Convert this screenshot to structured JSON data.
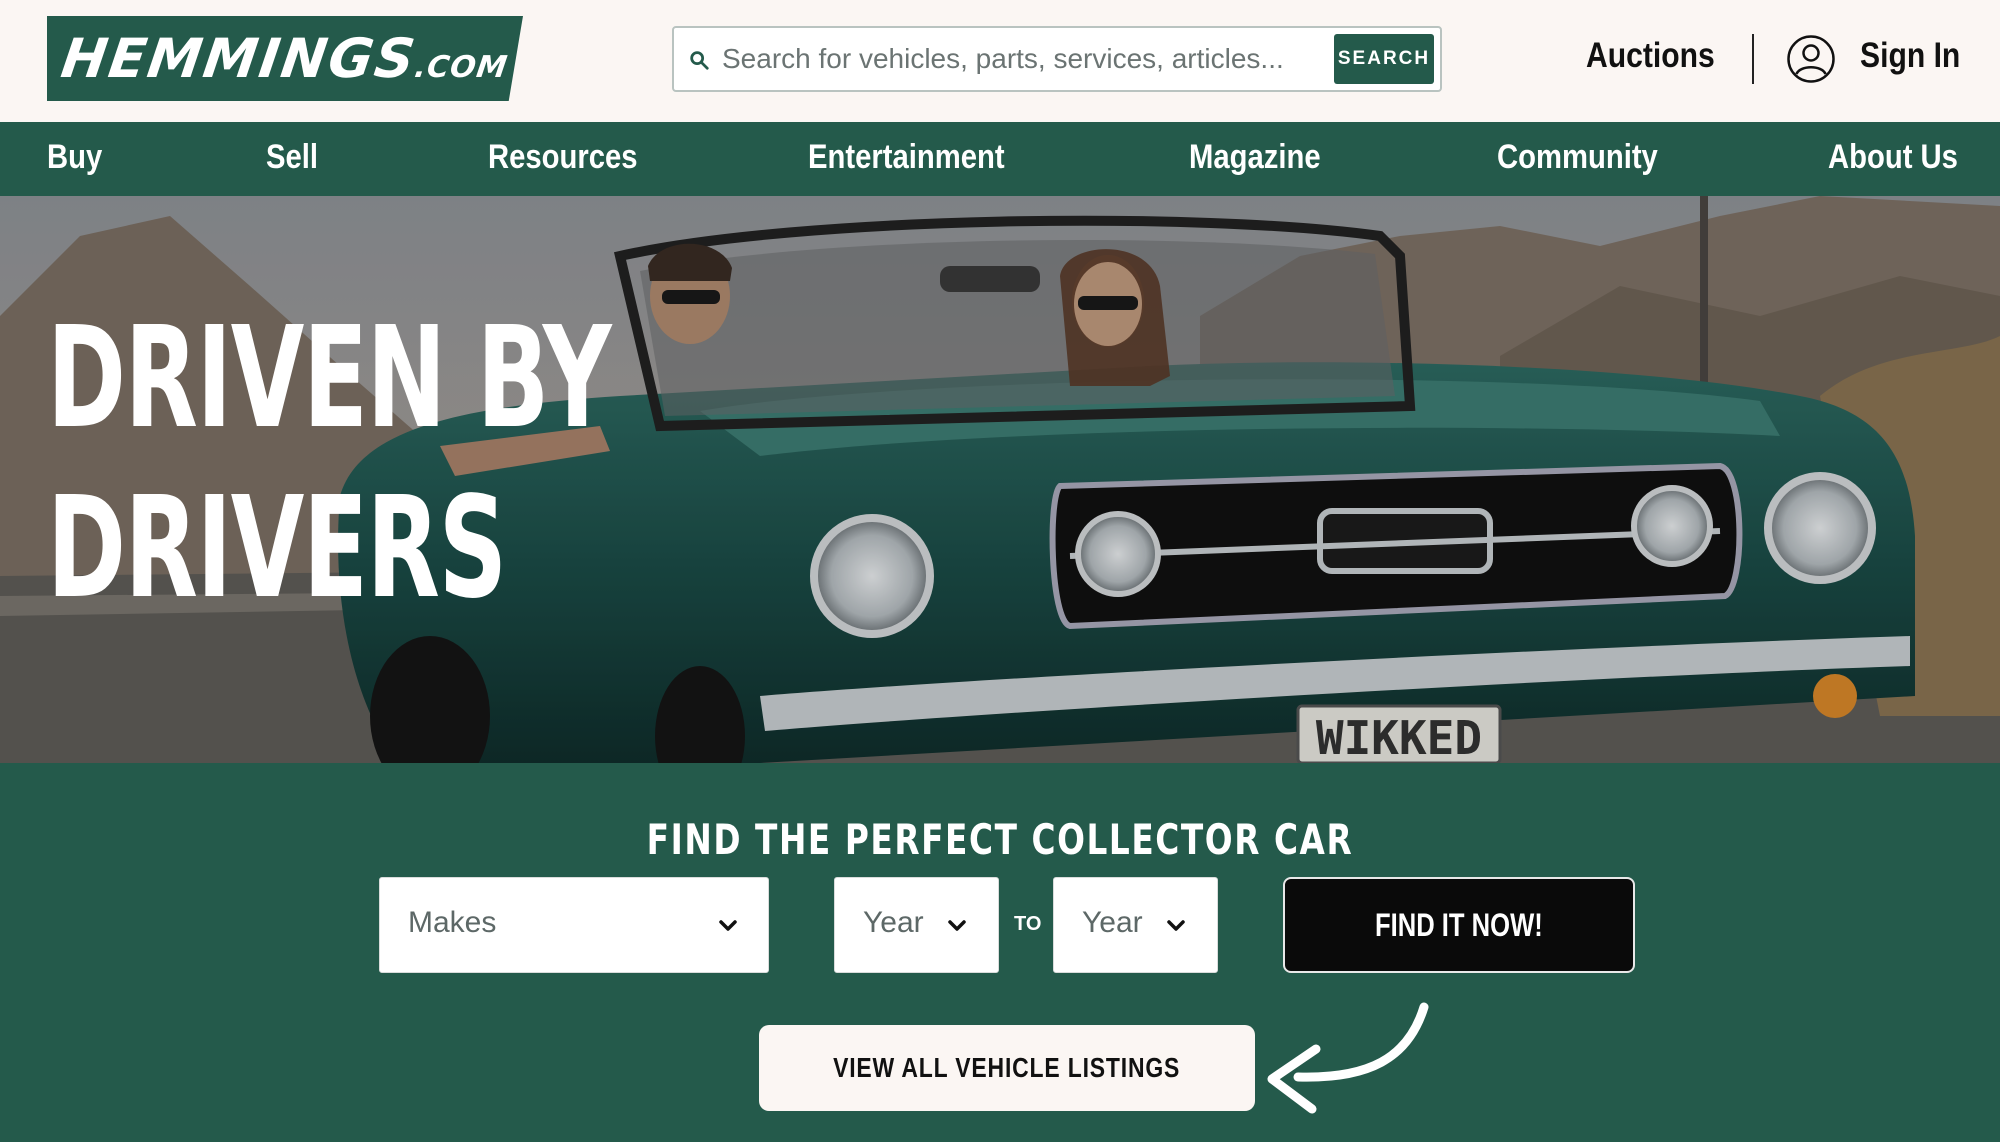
{
  "header": {
    "logo": {
      "main": "HEMMINGS",
      "suffix": ".COM"
    },
    "search": {
      "placeholder": "Search for vehicles, parts, services, articles...",
      "button_label": "SEARCH"
    },
    "auctions_label": "Auctions",
    "signin_label": "Sign In"
  },
  "nav": {
    "items": [
      {
        "label": "Buy"
      },
      {
        "label": "Sell"
      },
      {
        "label": "Resources"
      },
      {
        "label": "Entertainment"
      },
      {
        "label": "Magazine"
      },
      {
        "label": "Community"
      },
      {
        "label": "About Us"
      }
    ]
  },
  "hero": {
    "heading_line1": "DRIVEN BY",
    "heading_line2": "DRIVERS",
    "plate_text": "WIKKED"
  },
  "finder": {
    "title": "FIND THE PERFECT COLLECTOR CAR",
    "makes_label": "Makes",
    "year_from_label": "Year",
    "to_label": "TO",
    "year_to_label": "Year",
    "find_button_label": "FIND IT NOW!",
    "view_all_label": "VIEW ALL VEHICLE LISTINGS"
  },
  "colors": {
    "brand_green": "#245a4b",
    "background_cream": "#fbf6f3",
    "button_black": "#0a0a0a"
  },
  "icons": [
    "search-icon",
    "user-icon",
    "chevron-down-icon",
    "curved-arrow-icon"
  ]
}
